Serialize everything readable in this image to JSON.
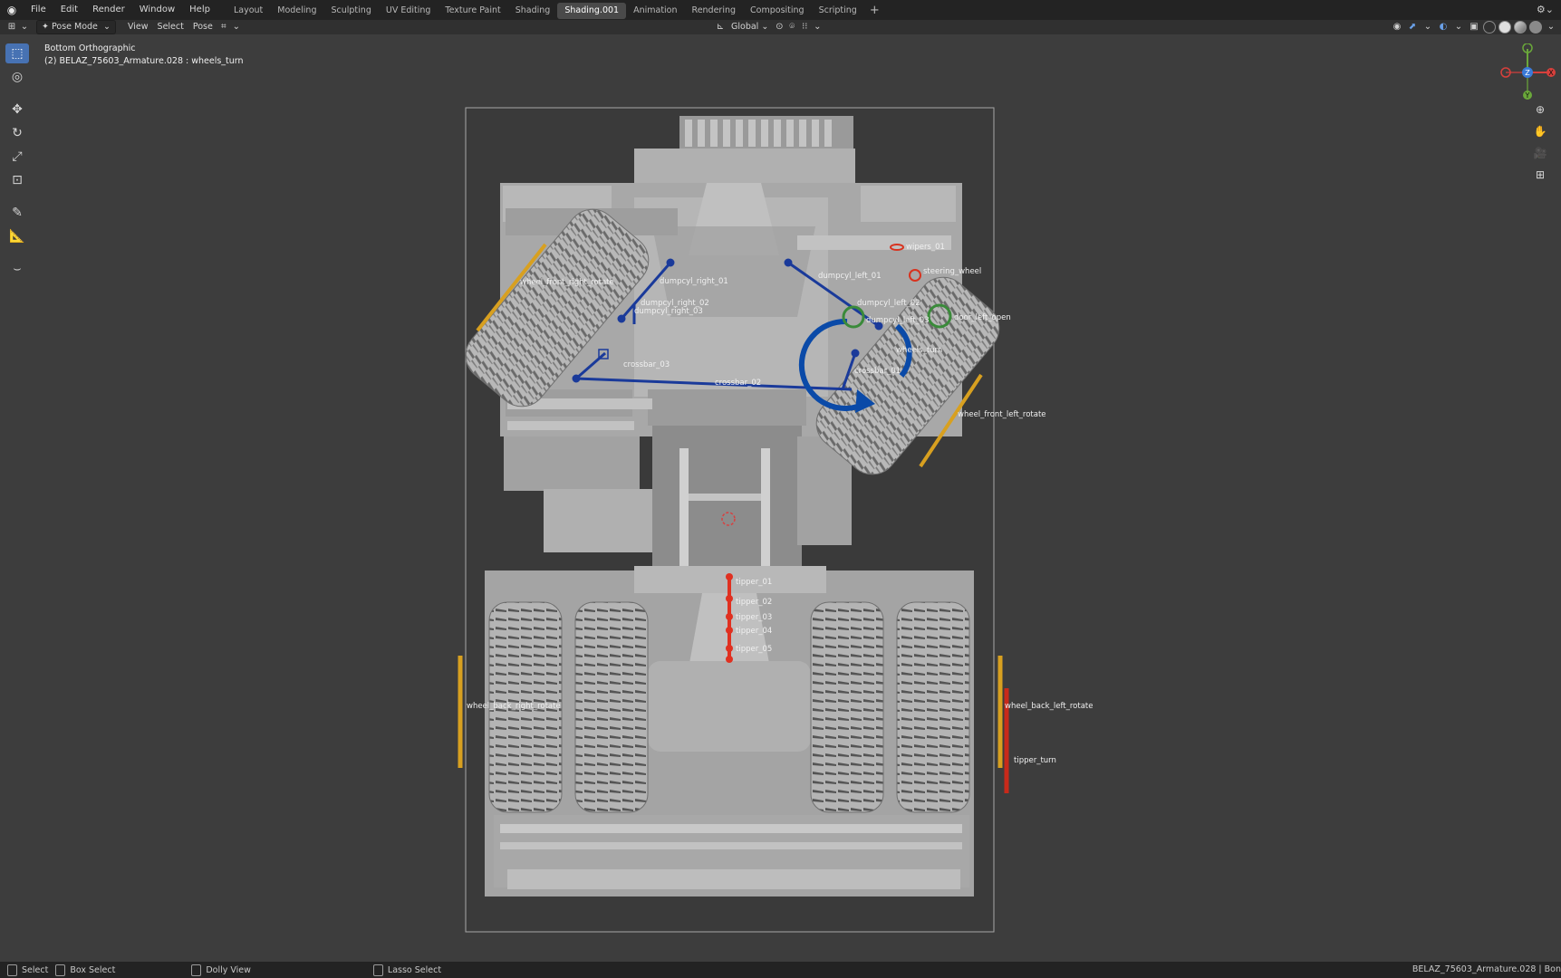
{
  "app": {
    "menu": [
      "File",
      "Edit",
      "Render",
      "Window",
      "Help"
    ],
    "workspace_tabs": [
      "Layout",
      "Modeling",
      "Sculpting",
      "UV Editing",
      "Texture Paint",
      "Shading",
      "Shading.001",
      "Animation",
      "Rendering",
      "Compositing",
      "Scripting"
    ],
    "active_tab": "Shading.001",
    "add_tab": "+"
  },
  "viewport_header": {
    "mode": "Pose Mode",
    "menus": [
      "View",
      "Select",
      "Pose"
    ],
    "transform_orientation": "Global"
  },
  "viewport": {
    "view_name": "Bottom Orthographic",
    "active_object": "(2) BELAZ_75603_Armature.028 : wheels_turn",
    "gizmo_axes": [
      "X",
      "Y",
      "Z"
    ]
  },
  "bones": {
    "wheel_front_right_rotate": "wheel_front_right_rotate",
    "dumpcyl_right_01": "dumpcyl_right_01",
    "dumpcyl_right_02": "dumpcyl_right_02",
    "dumpcyl_right_03": "dumpcyl_right_03",
    "dumpcyl_left_01": "dumpcyl_left_01",
    "dumpcyl_left_02": "dumpcyl_left_02",
    "dumpcyl_left_03": "dumpcyl_left_03",
    "wheels_turn": "wheels_turn",
    "wipers_01": "wipers_01",
    "steering_wheel": "steering_wheel",
    "door_left_open": "door_left_open",
    "crossbar_01": "crossbar_01",
    "crossbar_02": "crossbar_02",
    "crossbar_03": "crossbar_03",
    "wheel_front_left_rotate": "wheel_front_left_rotate",
    "tipper_01": "tipper_01",
    "tipper_02": "tipper_02",
    "tipper_03": "tipper_03",
    "tipper_04": "tipper_04",
    "tipper_05": "tipper_05",
    "wheel_back_right_rotate": "wheel_back_right_rotate",
    "wheel_back_left_rotate": "wheel_back_left_rotate",
    "tipper_turn": "tipper_turn"
  },
  "statusbar": {
    "select": "Select",
    "box_select": "Box Select",
    "dolly_view": "Dolly View",
    "lasso_select": "Lasso Select",
    "right_info": "BELAZ_75603_Armature.028 | Bon"
  },
  "colors": {
    "accent": "#4772b3",
    "bone_blue": "#1a3a9a",
    "bone_red": "#d8321e",
    "bone_yellow": "#d8a020",
    "bone_green": "#3a8a3a"
  }
}
